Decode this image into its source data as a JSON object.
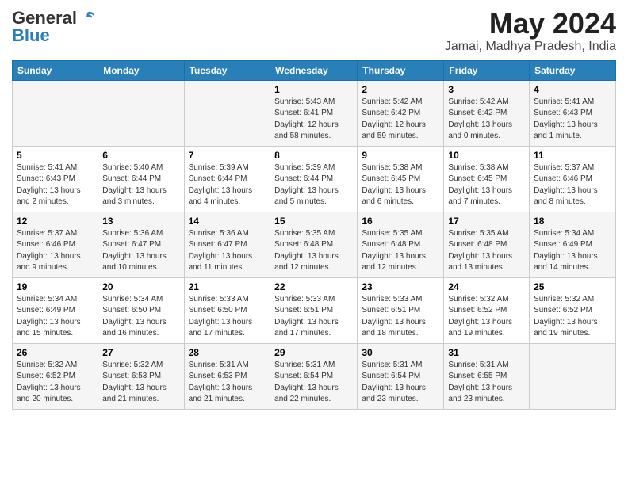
{
  "header": {
    "logo_general": "General",
    "logo_blue": "Blue",
    "title": "May 2024",
    "subtitle": "Jamai, Madhya Pradesh, India"
  },
  "days_of_week": [
    "Sunday",
    "Monday",
    "Tuesday",
    "Wednesday",
    "Thursday",
    "Friday",
    "Saturday"
  ],
  "weeks": [
    [
      {
        "day": "",
        "info": ""
      },
      {
        "day": "",
        "info": ""
      },
      {
        "day": "",
        "info": ""
      },
      {
        "day": "1",
        "info": "Sunrise: 5:43 AM\nSunset: 6:41 PM\nDaylight: 12 hours\nand 58 minutes."
      },
      {
        "day": "2",
        "info": "Sunrise: 5:42 AM\nSunset: 6:42 PM\nDaylight: 12 hours\nand 59 minutes."
      },
      {
        "day": "3",
        "info": "Sunrise: 5:42 AM\nSunset: 6:42 PM\nDaylight: 13 hours\nand 0 minutes."
      },
      {
        "day": "4",
        "info": "Sunrise: 5:41 AM\nSunset: 6:43 PM\nDaylight: 13 hours\nand 1 minute."
      }
    ],
    [
      {
        "day": "5",
        "info": "Sunrise: 5:41 AM\nSunset: 6:43 PM\nDaylight: 13 hours\nand 2 minutes."
      },
      {
        "day": "6",
        "info": "Sunrise: 5:40 AM\nSunset: 6:44 PM\nDaylight: 13 hours\nand 3 minutes."
      },
      {
        "day": "7",
        "info": "Sunrise: 5:39 AM\nSunset: 6:44 PM\nDaylight: 13 hours\nand 4 minutes."
      },
      {
        "day": "8",
        "info": "Sunrise: 5:39 AM\nSunset: 6:44 PM\nDaylight: 13 hours\nand 5 minutes."
      },
      {
        "day": "9",
        "info": "Sunrise: 5:38 AM\nSunset: 6:45 PM\nDaylight: 13 hours\nand 6 minutes."
      },
      {
        "day": "10",
        "info": "Sunrise: 5:38 AM\nSunset: 6:45 PM\nDaylight: 13 hours\nand 7 minutes."
      },
      {
        "day": "11",
        "info": "Sunrise: 5:37 AM\nSunset: 6:46 PM\nDaylight: 13 hours\nand 8 minutes."
      }
    ],
    [
      {
        "day": "12",
        "info": "Sunrise: 5:37 AM\nSunset: 6:46 PM\nDaylight: 13 hours\nand 9 minutes."
      },
      {
        "day": "13",
        "info": "Sunrise: 5:36 AM\nSunset: 6:47 PM\nDaylight: 13 hours\nand 10 minutes."
      },
      {
        "day": "14",
        "info": "Sunrise: 5:36 AM\nSunset: 6:47 PM\nDaylight: 13 hours\nand 11 minutes."
      },
      {
        "day": "15",
        "info": "Sunrise: 5:35 AM\nSunset: 6:48 PM\nDaylight: 13 hours\nand 12 minutes."
      },
      {
        "day": "16",
        "info": "Sunrise: 5:35 AM\nSunset: 6:48 PM\nDaylight: 13 hours\nand 12 minutes."
      },
      {
        "day": "17",
        "info": "Sunrise: 5:35 AM\nSunset: 6:48 PM\nDaylight: 13 hours\nand 13 minutes."
      },
      {
        "day": "18",
        "info": "Sunrise: 5:34 AM\nSunset: 6:49 PM\nDaylight: 13 hours\nand 14 minutes."
      }
    ],
    [
      {
        "day": "19",
        "info": "Sunrise: 5:34 AM\nSunset: 6:49 PM\nDaylight: 13 hours\nand 15 minutes."
      },
      {
        "day": "20",
        "info": "Sunrise: 5:34 AM\nSunset: 6:50 PM\nDaylight: 13 hours\nand 16 minutes."
      },
      {
        "day": "21",
        "info": "Sunrise: 5:33 AM\nSunset: 6:50 PM\nDaylight: 13 hours\nand 17 minutes."
      },
      {
        "day": "22",
        "info": "Sunrise: 5:33 AM\nSunset: 6:51 PM\nDaylight: 13 hours\nand 17 minutes."
      },
      {
        "day": "23",
        "info": "Sunrise: 5:33 AM\nSunset: 6:51 PM\nDaylight: 13 hours\nand 18 minutes."
      },
      {
        "day": "24",
        "info": "Sunrise: 5:32 AM\nSunset: 6:52 PM\nDaylight: 13 hours\nand 19 minutes."
      },
      {
        "day": "25",
        "info": "Sunrise: 5:32 AM\nSunset: 6:52 PM\nDaylight: 13 hours\nand 19 minutes."
      }
    ],
    [
      {
        "day": "26",
        "info": "Sunrise: 5:32 AM\nSunset: 6:52 PM\nDaylight: 13 hours\nand 20 minutes."
      },
      {
        "day": "27",
        "info": "Sunrise: 5:32 AM\nSunset: 6:53 PM\nDaylight: 13 hours\nand 21 minutes."
      },
      {
        "day": "28",
        "info": "Sunrise: 5:31 AM\nSunset: 6:53 PM\nDaylight: 13 hours\nand 21 minutes."
      },
      {
        "day": "29",
        "info": "Sunrise: 5:31 AM\nSunset: 6:54 PM\nDaylight: 13 hours\nand 22 minutes."
      },
      {
        "day": "30",
        "info": "Sunrise: 5:31 AM\nSunset: 6:54 PM\nDaylight: 13 hours\nand 23 minutes."
      },
      {
        "day": "31",
        "info": "Sunrise: 5:31 AM\nSunset: 6:55 PM\nDaylight: 13 hours\nand 23 minutes."
      },
      {
        "day": "",
        "info": ""
      }
    ]
  ]
}
